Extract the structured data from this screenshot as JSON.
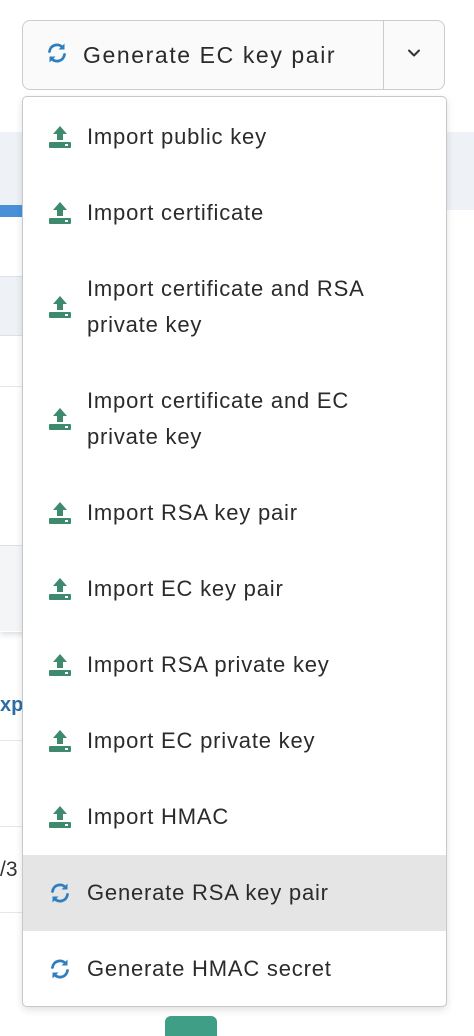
{
  "split_button": {
    "label": "Generate EC key pair",
    "icon": "refresh-icon",
    "caret_icon": "chevron-down-icon"
  },
  "menu": {
    "items": [
      {
        "label": "Import public key",
        "icon": "upload-icon"
      },
      {
        "label": "Import certificate",
        "icon": "upload-icon"
      },
      {
        "label": "Import certificate and RSA private key",
        "icon": "upload-icon"
      },
      {
        "label": "Import certificate and EC private key",
        "icon": "upload-icon"
      },
      {
        "label": "Import RSA key pair",
        "icon": "upload-icon"
      },
      {
        "label": "Import EC key pair",
        "icon": "upload-icon"
      },
      {
        "label": "Import RSA private key",
        "icon": "upload-icon"
      },
      {
        "label": "Import EC private key",
        "icon": "upload-icon"
      },
      {
        "label": "Import HMAC",
        "icon": "upload-icon"
      },
      {
        "label": "Generate RSA key pair",
        "icon": "refresh-icon",
        "highlighted": true
      },
      {
        "label": "Generate HMAC secret",
        "icon": "refresh-icon"
      }
    ]
  },
  "background": {
    "partial_header_text": "xp",
    "partial_cell_text": "/3"
  },
  "colors": {
    "import_icon": "#3e8a6e",
    "generate_icon": "#2f7fc0",
    "highlight": "#e5e5e5",
    "accent_green": "#3e9e86"
  }
}
